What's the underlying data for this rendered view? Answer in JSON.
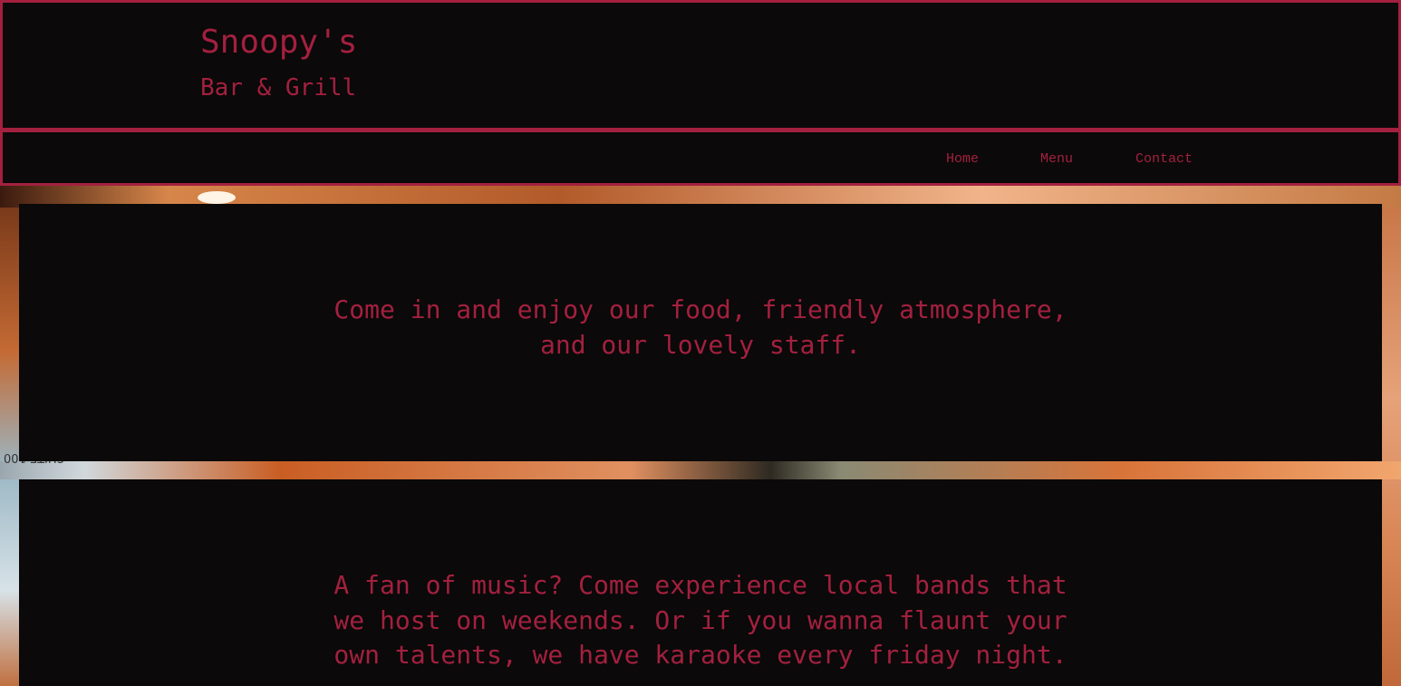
{
  "header": {
    "title": "Snoopy's",
    "subtitle": "Bar & Grill"
  },
  "nav": {
    "items": [
      {
        "label": "Home"
      },
      {
        "label": "Menu"
      },
      {
        "label": "Contact"
      }
    ]
  },
  "background": {
    "sign_text": "SUITE 100"
  },
  "sections": [
    {
      "text": "Come in and enjoy our food, friendly atmosphere, and our lovely staff."
    },
    {
      "text": "A fan of music? Come experience local bands that we host on weekends. Or if you wanna flaunt your own talents, we have karaoke every friday night."
    }
  ],
  "colors": {
    "accent": "#a3203f",
    "background": "#0b0909"
  }
}
